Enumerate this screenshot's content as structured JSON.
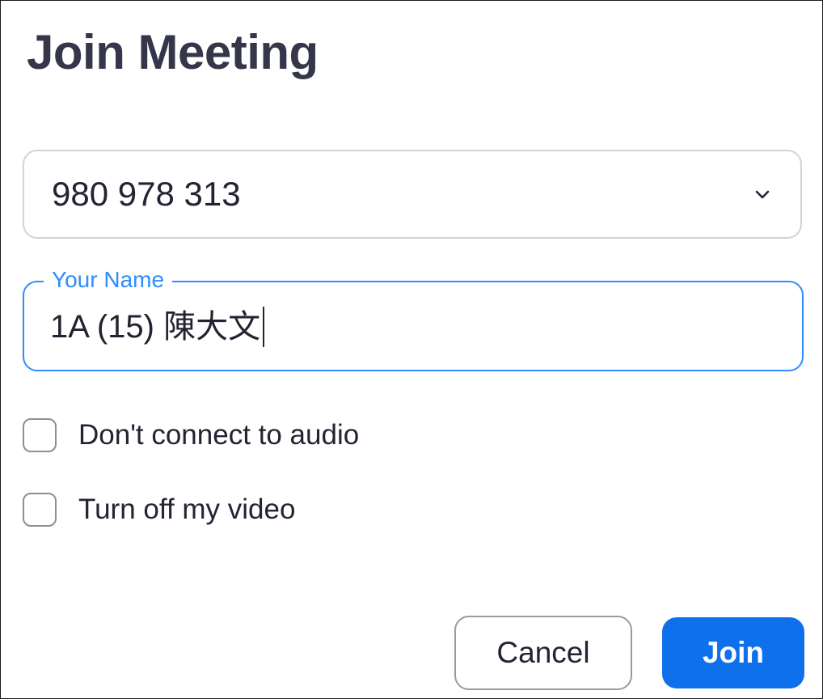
{
  "dialog": {
    "title": "Join Meeting"
  },
  "meeting_id": {
    "value": "980 978 313",
    "icon": "chevron-down-icon"
  },
  "name_field": {
    "label": "Your Name",
    "value": "1A (15) 陳大文"
  },
  "options": [
    {
      "label": "Don't connect to audio",
      "checked": false
    },
    {
      "label": "Turn off my video",
      "checked": false
    }
  ],
  "actions": {
    "cancel_label": "Cancel",
    "join_label": "Join"
  },
  "colors": {
    "accent": "#2d8cff",
    "join_button": "#0e71eb",
    "title_text": "#35364a"
  }
}
